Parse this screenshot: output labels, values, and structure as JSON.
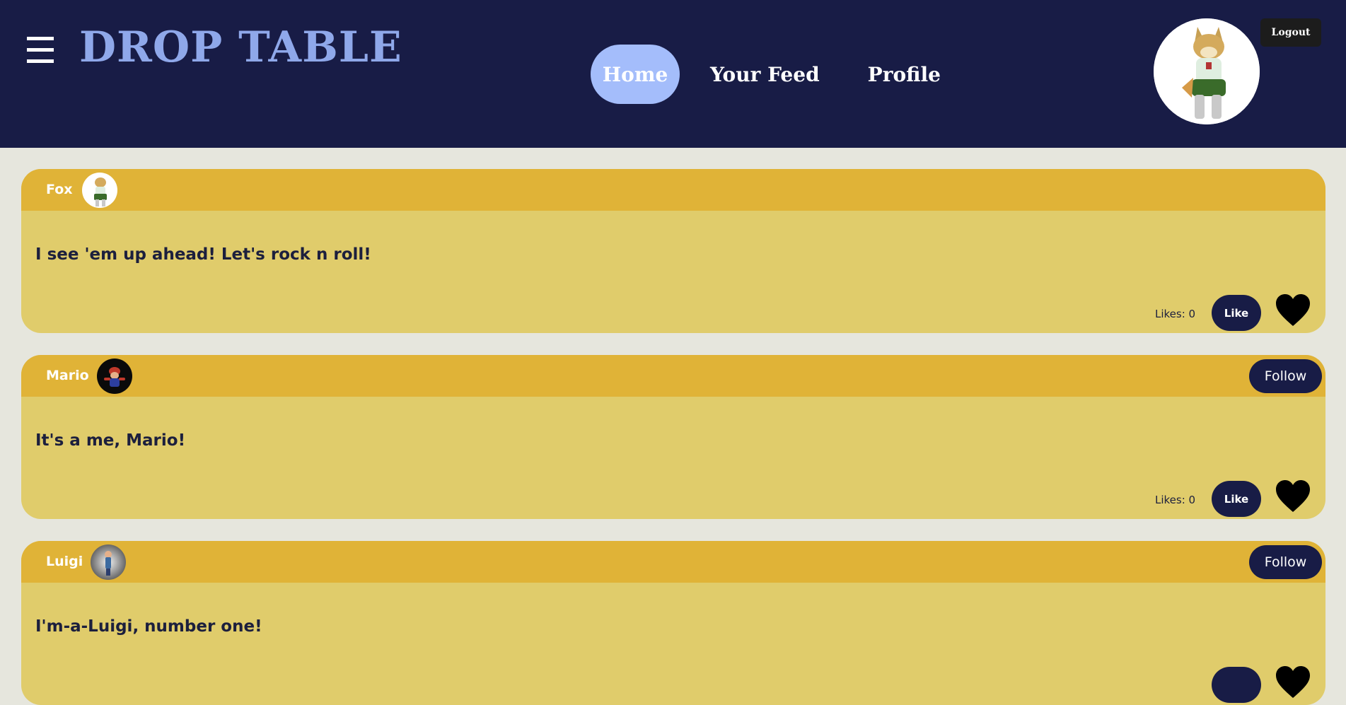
{
  "header": {
    "brand": "DROP TABLE",
    "menu_icon": "hamburger-menu-icon",
    "nav": [
      {
        "label": "Home",
        "active": true
      },
      {
        "label": "Your Feed",
        "active": false
      },
      {
        "label": "Profile",
        "active": false
      }
    ],
    "logout_label": "Logout",
    "avatar_icon": "fox-avatar"
  },
  "colors": {
    "header_bg": "#181c46",
    "brand": "#8fa8ea",
    "nav_active_bg": "#a4bdfb",
    "page_bg": "#e6e6dd",
    "post_header_bg": "#e0b337",
    "post_body_bg": "#e0cc6b",
    "button_bg": "#181c46"
  },
  "posts": [
    {
      "author": "Fox",
      "avatar_icon": "fox-avatar",
      "text": "I see 'em up ahead! Let's rock n roll!",
      "likes_text": "Likes: 0",
      "like_label": "Like",
      "show_follow": false,
      "follow_label": ""
    },
    {
      "author": "Mario",
      "avatar_icon": "mario-avatar",
      "text": "It's a me, Mario!",
      "likes_text": "Likes: 0",
      "like_label": "Like",
      "show_follow": true,
      "follow_label": "Follow"
    },
    {
      "author": "Luigi",
      "avatar_icon": "luigi-avatar",
      "text": "I'm-a-Luigi, number one!",
      "likes_text": "",
      "like_label": "",
      "show_follow": true,
      "follow_label": "Follow"
    }
  ]
}
